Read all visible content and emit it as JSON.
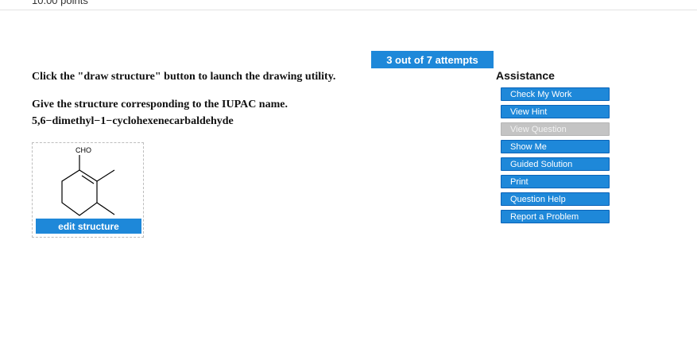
{
  "header": {
    "points": "10.00 points"
  },
  "attempts": {
    "label": "3 out of 7 attempts"
  },
  "question": {
    "instruction": "Click the \"draw structure\" button to launch the drawing utility.",
    "prompt": "Give the structure corresponding to the IUPAC name.",
    "iupac_name": "5,6−dimethyl−1−cyclohexenecarbaldehyde"
  },
  "drawing": {
    "group_label": "CHO",
    "edit_label": "edit structure"
  },
  "assistance": {
    "title": "Assistance",
    "buttons": [
      {
        "label": "Check My Work",
        "enabled": true
      },
      {
        "label": "View Hint",
        "enabled": true
      },
      {
        "label": "View Question",
        "enabled": false
      },
      {
        "label": "Show Me",
        "enabled": true
      },
      {
        "label": "Guided Solution",
        "enabled": true
      },
      {
        "label": "Print",
        "enabled": true
      },
      {
        "label": "Question Help",
        "enabled": true
      },
      {
        "label": "Report a Problem",
        "enabled": true
      }
    ]
  },
  "colors": {
    "accent": "#1e88d9",
    "disabled": "#c4c4c4"
  }
}
